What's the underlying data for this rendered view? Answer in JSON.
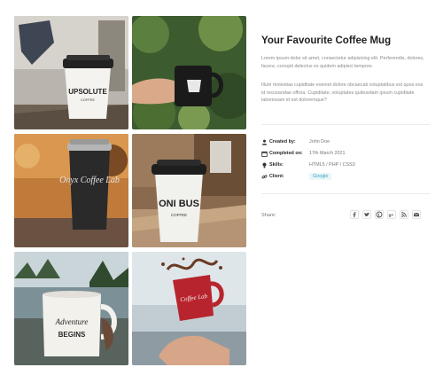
{
  "project": {
    "title": "Your Favourite Coffee Mug",
    "description_1": "Lorem ipsum dolor sit amet, consectetur adipisicing elit. Perferendis, dolores, facere, corrupti delectus ex quidem adipisci tempore.",
    "description_2": "Illum molestias cupiditate eveniet dolore obcaecati voluptatibus est quos eos id recusandae officia. Cupiditate, voluptates quibusdam ipsum cupiditate laboriosam id est doloremque?"
  },
  "meta": {
    "created_by": {
      "label": "Created by:",
      "value": "John Doe",
      "icon": "user-icon"
    },
    "completed_on": {
      "label": "Completed on:",
      "value": "17th March 2021",
      "icon": "calendar-icon"
    },
    "skills": {
      "label": "Skills:",
      "value": "HTML5 / PHP / CSS3",
      "icon": "lightbulb-icon"
    },
    "client": {
      "label": "Client:",
      "value": "Google",
      "icon": "link-icon"
    }
  },
  "share": {
    "label": "Share:",
    "icons": [
      "facebook-icon",
      "twitter-icon",
      "pinterest-icon",
      "google-plus-icon",
      "rss-icon",
      "email-icon"
    ]
  },
  "gallery": {
    "images": [
      {
        "name": "white-upsolute-cup-photo",
        "logo_text": "UPSOLUTE",
        "logo_sub": "COFFEE"
      },
      {
        "name": "black-mug-in-hand-photo"
      },
      {
        "name": "black-onyx-coffee-tumbler-photo",
        "logo_text": "Onyx Coffee Lab"
      },
      {
        "name": "onibus-coffee-cup-photo",
        "logo_text": "ONI BUS",
        "logo_sub": "COFFEE"
      },
      {
        "name": "adventure-begins-enamel-mug-photo",
        "logo_text": "Adventure",
        "logo_sub": "BEGINS"
      },
      {
        "name": "red-mug-splash-photo",
        "logo_text": "Coffee Lab"
      }
    ]
  },
  "colors": {
    "accent": "#39a5c4",
    "title": "#1f1f1f",
    "body_text": "#8a8a8a",
    "separator": "#ececec"
  }
}
